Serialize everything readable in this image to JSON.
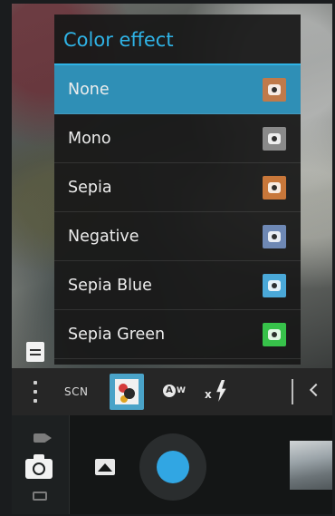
{
  "popup": {
    "title": "Color effect",
    "options": [
      {
        "label": "None",
        "selected": true,
        "thumb_color": "#c07a4a"
      },
      {
        "label": "Mono",
        "selected": false,
        "thumb_color": "#8a8a8a"
      },
      {
        "label": "Sepia",
        "selected": false,
        "thumb_color": "#c8773a"
      },
      {
        "label": "Negative",
        "selected": false,
        "thumb_color": "#6e88b4"
      },
      {
        "label": "Sepia Blue",
        "selected": false,
        "thumb_color": "#4aa8d8"
      },
      {
        "label": "Sepia Green",
        "selected": false,
        "thumb_color": "#37c24a"
      }
    ],
    "accent": "#2fb3e6",
    "selected_bg": "#2f8fb6"
  },
  "settings_strip": {
    "scene_label": "SCN",
    "icons": [
      "more-icon",
      "color-effect-icon",
      "white-balance-icon",
      "flash-off-icon",
      "collapse-icon"
    ]
  },
  "controls": {
    "shutter_color": "#31a6e3",
    "mode_icons": [
      "video-icon",
      "camera-icon",
      "panorama-icon"
    ]
  }
}
